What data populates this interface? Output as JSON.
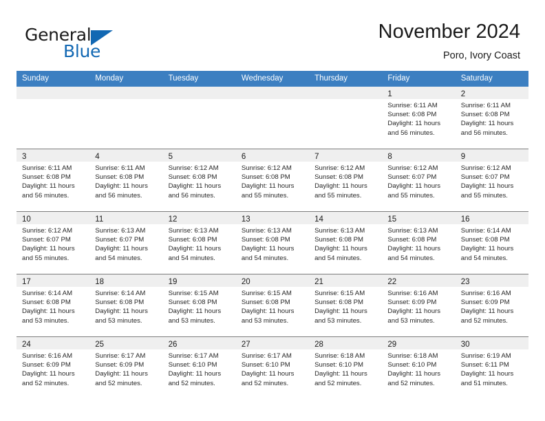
{
  "brand": {
    "line1": "General",
    "line2": "Blue",
    "triangle_color": "#1268b3"
  },
  "header": {
    "title": "November 2024",
    "subtitle": "Poro, Ivory Coast"
  },
  "theme": {
    "header_row_bg": "#3c7fc1",
    "day_band_bg": "#efefef",
    "grid_line": "#7c7c7c",
    "text": "#1a1a1a"
  },
  "weekdays": [
    "Sunday",
    "Monday",
    "Tuesday",
    "Wednesday",
    "Thursday",
    "Friday",
    "Saturday"
  ],
  "weeks": [
    [
      {
        "day": "",
        "empty": true
      },
      {
        "day": "",
        "empty": true
      },
      {
        "day": "",
        "empty": true
      },
      {
        "day": "",
        "empty": true
      },
      {
        "day": "",
        "empty": true
      },
      {
        "day": "1",
        "sunrise": "Sunrise: 6:11 AM",
        "sunset": "Sunset: 6:08 PM",
        "daylight1": "Daylight: 11 hours",
        "daylight2": "and 56 minutes."
      },
      {
        "day": "2",
        "sunrise": "Sunrise: 6:11 AM",
        "sunset": "Sunset: 6:08 PM",
        "daylight1": "Daylight: 11 hours",
        "daylight2": "and 56 minutes."
      }
    ],
    [
      {
        "day": "3",
        "sunrise": "Sunrise: 6:11 AM",
        "sunset": "Sunset: 6:08 PM",
        "daylight1": "Daylight: 11 hours",
        "daylight2": "and 56 minutes."
      },
      {
        "day": "4",
        "sunrise": "Sunrise: 6:11 AM",
        "sunset": "Sunset: 6:08 PM",
        "daylight1": "Daylight: 11 hours",
        "daylight2": "and 56 minutes."
      },
      {
        "day": "5",
        "sunrise": "Sunrise: 6:12 AM",
        "sunset": "Sunset: 6:08 PM",
        "daylight1": "Daylight: 11 hours",
        "daylight2": "and 56 minutes."
      },
      {
        "day": "6",
        "sunrise": "Sunrise: 6:12 AM",
        "sunset": "Sunset: 6:08 PM",
        "daylight1": "Daylight: 11 hours",
        "daylight2": "and 55 minutes."
      },
      {
        "day": "7",
        "sunrise": "Sunrise: 6:12 AM",
        "sunset": "Sunset: 6:08 PM",
        "daylight1": "Daylight: 11 hours",
        "daylight2": "and 55 minutes."
      },
      {
        "day": "8",
        "sunrise": "Sunrise: 6:12 AM",
        "sunset": "Sunset: 6:07 PM",
        "daylight1": "Daylight: 11 hours",
        "daylight2": "and 55 minutes."
      },
      {
        "day": "9",
        "sunrise": "Sunrise: 6:12 AM",
        "sunset": "Sunset: 6:07 PM",
        "daylight1": "Daylight: 11 hours",
        "daylight2": "and 55 minutes."
      }
    ],
    [
      {
        "day": "10",
        "sunrise": "Sunrise: 6:12 AM",
        "sunset": "Sunset: 6:07 PM",
        "daylight1": "Daylight: 11 hours",
        "daylight2": "and 55 minutes."
      },
      {
        "day": "11",
        "sunrise": "Sunrise: 6:13 AM",
        "sunset": "Sunset: 6:07 PM",
        "daylight1": "Daylight: 11 hours",
        "daylight2": "and 54 minutes."
      },
      {
        "day": "12",
        "sunrise": "Sunrise: 6:13 AM",
        "sunset": "Sunset: 6:08 PM",
        "daylight1": "Daylight: 11 hours",
        "daylight2": "and 54 minutes."
      },
      {
        "day": "13",
        "sunrise": "Sunrise: 6:13 AM",
        "sunset": "Sunset: 6:08 PM",
        "daylight1": "Daylight: 11 hours",
        "daylight2": "and 54 minutes."
      },
      {
        "day": "14",
        "sunrise": "Sunrise: 6:13 AM",
        "sunset": "Sunset: 6:08 PM",
        "daylight1": "Daylight: 11 hours",
        "daylight2": "and 54 minutes."
      },
      {
        "day": "15",
        "sunrise": "Sunrise: 6:13 AM",
        "sunset": "Sunset: 6:08 PM",
        "daylight1": "Daylight: 11 hours",
        "daylight2": "and 54 minutes."
      },
      {
        "day": "16",
        "sunrise": "Sunrise: 6:14 AM",
        "sunset": "Sunset: 6:08 PM",
        "daylight1": "Daylight: 11 hours",
        "daylight2": "and 54 minutes."
      }
    ],
    [
      {
        "day": "17",
        "sunrise": "Sunrise: 6:14 AM",
        "sunset": "Sunset: 6:08 PM",
        "daylight1": "Daylight: 11 hours",
        "daylight2": "and 53 minutes."
      },
      {
        "day": "18",
        "sunrise": "Sunrise: 6:14 AM",
        "sunset": "Sunset: 6:08 PM",
        "daylight1": "Daylight: 11 hours",
        "daylight2": "and 53 minutes."
      },
      {
        "day": "19",
        "sunrise": "Sunrise: 6:15 AM",
        "sunset": "Sunset: 6:08 PM",
        "daylight1": "Daylight: 11 hours",
        "daylight2": "and 53 minutes."
      },
      {
        "day": "20",
        "sunrise": "Sunrise: 6:15 AM",
        "sunset": "Sunset: 6:08 PM",
        "daylight1": "Daylight: 11 hours",
        "daylight2": "and 53 minutes."
      },
      {
        "day": "21",
        "sunrise": "Sunrise: 6:15 AM",
        "sunset": "Sunset: 6:08 PM",
        "daylight1": "Daylight: 11 hours",
        "daylight2": "and 53 minutes."
      },
      {
        "day": "22",
        "sunrise": "Sunrise: 6:16 AM",
        "sunset": "Sunset: 6:09 PM",
        "daylight1": "Daylight: 11 hours",
        "daylight2": "and 53 minutes."
      },
      {
        "day": "23",
        "sunrise": "Sunrise: 6:16 AM",
        "sunset": "Sunset: 6:09 PM",
        "daylight1": "Daylight: 11 hours",
        "daylight2": "and 52 minutes."
      }
    ],
    [
      {
        "day": "24",
        "sunrise": "Sunrise: 6:16 AM",
        "sunset": "Sunset: 6:09 PM",
        "daylight1": "Daylight: 11 hours",
        "daylight2": "and 52 minutes."
      },
      {
        "day": "25",
        "sunrise": "Sunrise: 6:17 AM",
        "sunset": "Sunset: 6:09 PM",
        "daylight1": "Daylight: 11 hours",
        "daylight2": "and 52 minutes."
      },
      {
        "day": "26",
        "sunrise": "Sunrise: 6:17 AM",
        "sunset": "Sunset: 6:10 PM",
        "daylight1": "Daylight: 11 hours",
        "daylight2": "and 52 minutes."
      },
      {
        "day": "27",
        "sunrise": "Sunrise: 6:17 AM",
        "sunset": "Sunset: 6:10 PM",
        "daylight1": "Daylight: 11 hours",
        "daylight2": "and 52 minutes."
      },
      {
        "day": "28",
        "sunrise": "Sunrise: 6:18 AM",
        "sunset": "Sunset: 6:10 PM",
        "daylight1": "Daylight: 11 hours",
        "daylight2": "and 52 minutes."
      },
      {
        "day": "29",
        "sunrise": "Sunrise: 6:18 AM",
        "sunset": "Sunset: 6:10 PM",
        "daylight1": "Daylight: 11 hours",
        "daylight2": "and 52 minutes."
      },
      {
        "day": "30",
        "sunrise": "Sunrise: 6:19 AM",
        "sunset": "Sunset: 6:11 PM",
        "daylight1": "Daylight: 11 hours",
        "daylight2": "and 51 minutes."
      }
    ]
  ]
}
